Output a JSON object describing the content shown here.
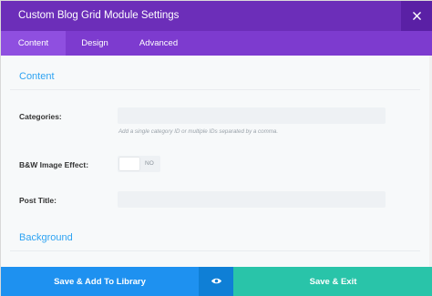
{
  "header": {
    "title": "Custom Blog Grid Module Settings"
  },
  "tabs": [
    {
      "label": "Content",
      "active": true
    },
    {
      "label": "Design",
      "active": false
    },
    {
      "label": "Advanced",
      "active": false
    }
  ],
  "content": {
    "section_title": "Content",
    "fields": {
      "categories": {
        "label": "Categories:",
        "value": "",
        "hint": "Add a single category ID or multiple IDs separated by a comma."
      },
      "bw_effect": {
        "label": "B&W Image Effect:",
        "state": "NO"
      },
      "post_title": {
        "label": "Post Title:",
        "value": ""
      }
    },
    "background_title": "Background"
  },
  "footer": {
    "add_to_library": "Save & Add To Library",
    "save_exit": "Save & Exit"
  },
  "colors": {
    "header": "#6c2eb9",
    "tabs": "#7d3bcf",
    "accent_text": "#2ea3f2",
    "btn_library": "#1e91f0",
    "btn_save": "#29c4a9"
  },
  "icons": {
    "close": "close-icon",
    "preview": "eye-icon"
  }
}
